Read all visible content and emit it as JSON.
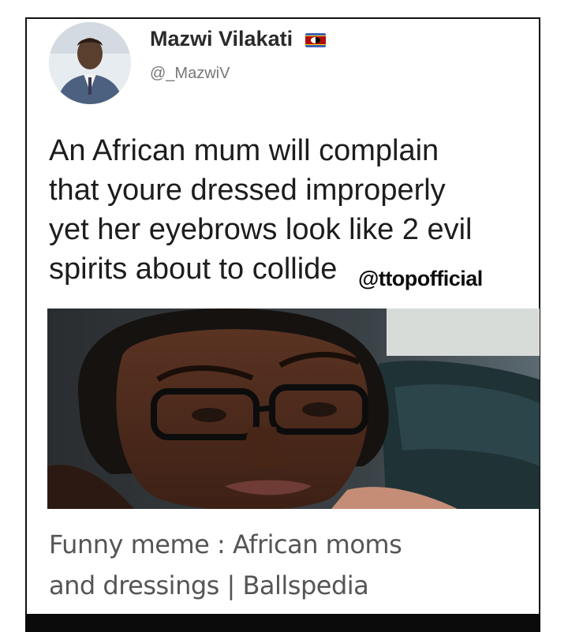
{
  "tweet": {
    "display_name": "Mazwi Vilakati",
    "handle": "@_MazwiV",
    "text_lines": [
      "An African mum will complain",
      "that youre dressed improperly",
      "yet her eyebrows look like 2 evil",
      "spirits about to collide"
    ],
    "avatar_icon": "profile-photo-icon",
    "flag_icon": "eswatini-flag-icon"
  },
  "watermark": "@ttopofficial",
  "photo": {
    "icon": "woman-with-glasses-photo"
  },
  "caption_lines": [
    "Funny meme : African moms",
    "and dressings | Ballspedia"
  ],
  "colors": {
    "text": "#1d1d1d",
    "handle": "#777777",
    "caption": "#555555",
    "frame": "#0b0b0b"
  }
}
